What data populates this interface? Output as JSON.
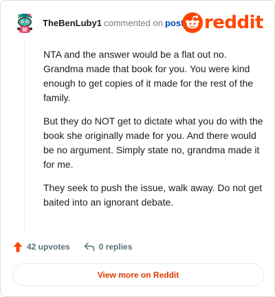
{
  "comment": {
    "author": "TheBenLuby1",
    "action_text": "commented on",
    "post_link": "post",
    "avatar_icon": "snoo-avatar-icon",
    "paragraphs": [
      "NTA and the answer would be a flat out no. Grandma made that book for you. You were kind enough to get copies of it made for the rest of the family.",
      "But they do NOT get to dictate what you do with the book she originally made for you. And there would be no argument. Simply state no, grandma made it for me.",
      "They seek to push the issue, walk away. Do not get baited into an ignorant debate."
    ]
  },
  "brand": {
    "wordmark": "reddit",
    "icon": "reddit-snoo-icon",
    "color": "#ff4500"
  },
  "stats": {
    "upvotes": "42 upvotes",
    "replies": "0 replies",
    "upvote_icon": "upvote-arrow-icon",
    "reply_icon": "reply-arrow-icon",
    "upvote_color": "#ff4500"
  },
  "cta": {
    "label": "View more on Reddit",
    "color": "#d93a00"
  },
  "colors": {
    "author_link": "#0045ac",
    "muted": "#576f76"
  }
}
